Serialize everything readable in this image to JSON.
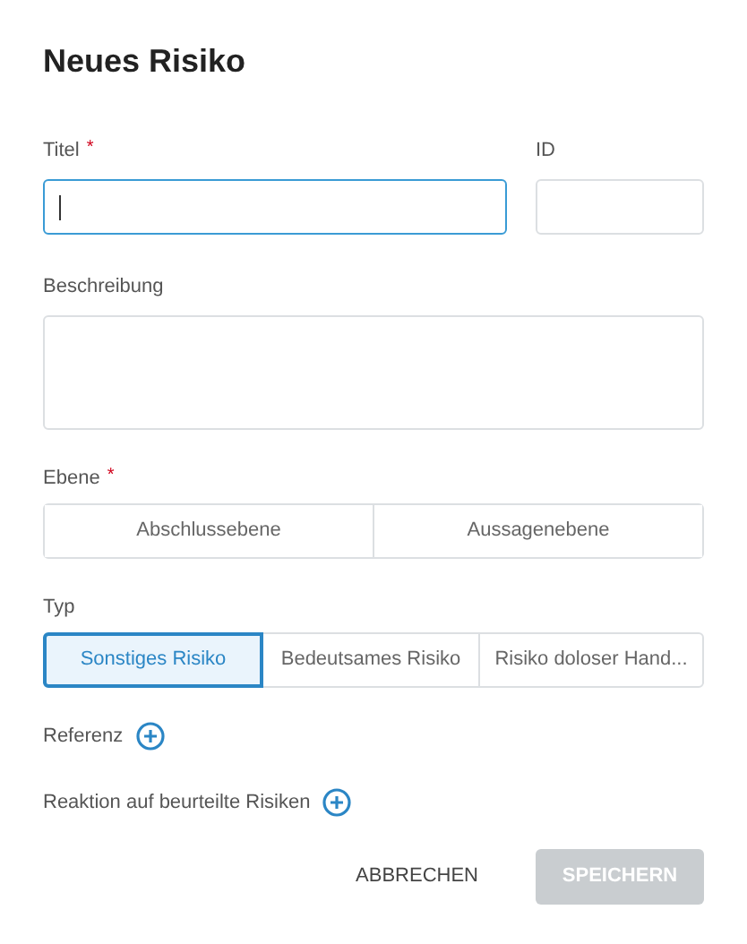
{
  "dialog": {
    "title": "Neues Risiko"
  },
  "title_field": {
    "label": "Titel",
    "required_mark": "*",
    "focused": true
  },
  "id_field": {
    "label": "ID",
    "focused": false
  },
  "description_field": {
    "label": "Beschreibung"
  },
  "level_group": {
    "label": "Ebene",
    "required_mark": "*",
    "options": [
      {
        "label": "Abschlussebene",
        "selected": false
      },
      {
        "label": "Aussagenebene",
        "selected": false
      }
    ]
  },
  "type_group": {
    "label": "Typ",
    "options": [
      {
        "label": "Sonstiges Risiko",
        "selected": true
      },
      {
        "label": "Bedeutsames Risiko",
        "selected": false
      },
      {
        "label": "Risiko doloser Hand...",
        "selected": false
      }
    ]
  },
  "add_rows": [
    {
      "label": "Referenz"
    },
    {
      "label": "Reaktion auf beurteilte Risiken"
    }
  ],
  "buttons": [
    {
      "label": "ABBRECHEN",
      "kind": "text",
      "disabled": false
    },
    {
      "label": "SPEICHERN",
      "kind": "filled",
      "disabled": true
    }
  ]
}
